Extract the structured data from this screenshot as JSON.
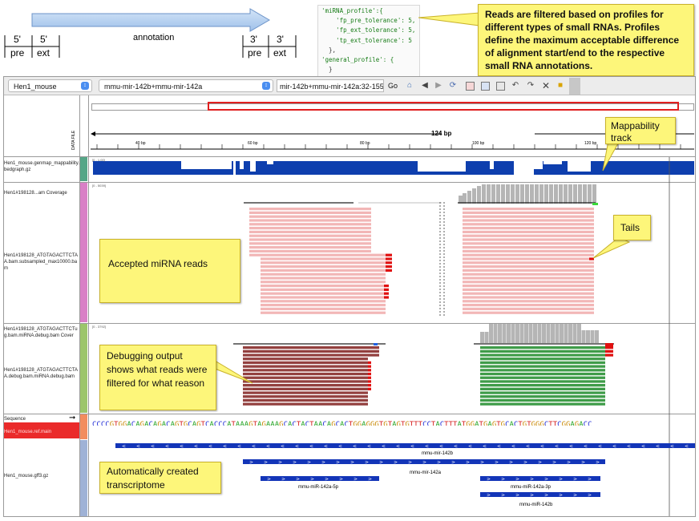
{
  "diagram": {
    "labels": [
      {
        "id": "five-pre",
        "text": "5'"
      },
      {
        "id": "five-pre-sub",
        "text": "pre"
      },
      {
        "id": "five-ext",
        "text": "5'"
      },
      {
        "id": "five-ext-sub",
        "text": "ext"
      },
      {
        "id": "annotation",
        "text": "annotation"
      },
      {
        "id": "three-pre",
        "text": "3'"
      },
      {
        "id": "three-pre-sub",
        "text": "pre"
      },
      {
        "id": "three-ext",
        "text": "3'"
      },
      {
        "id": "three-ext-sub",
        "text": "ext"
      }
    ]
  },
  "code": {
    "lines": [
      "'miRNA_profile':{",
      "    'fp_pre_tolerance': 5,",
      "    'fp_ext_tolerance': 5,",
      "    'tp_ext_tolerance': 5",
      "  },",
      "'general_profile': {",
      "  }"
    ]
  },
  "callouts": {
    "profiles": "Reads are filtered based on profiles for different types of small RNAs. Profiles define the maximum acceptable difference of alignment start/end to the respective small RNA annotations.",
    "mappability": "Mappability track",
    "tails": "Tails",
    "accepted": "Accepted miRNA reads",
    "debugging": "Debugging output shows what reads were filtered for what reason",
    "transcriptome": "Automatically created transcriptome"
  },
  "toolbar": {
    "genome": "Hen1_mouse",
    "locus_dropdown": "mmu-mir-142b+mmu-mir-142a",
    "locus_input": "mir-142b+mmu-mir-142a:32-155",
    "go": "Go"
  },
  "ruler": {
    "span": "124 bp",
    "ticks": [
      "40 bp",
      "60 bp",
      "80 bp",
      "100 bp",
      "120 bp"
    ],
    "data_file_label": "DATA FILE"
  },
  "tracks": {
    "mappability_label": "Hen1_mouse.genmap_mappability.bedgraph.gz",
    "mappability_range": "[0 - 1.00]",
    "coverage1_label": "Hen1#198128...am Coverage",
    "coverage1_range": "[0 - 5039]",
    "reads1_label": "Hen1#198128_ATGTAGACTTCTAA.bam.subsampled_max10000.bam",
    "coverage2_label": "Hen1#198128_ATGTAGACTTCTug.bam.miRNA.debug.bam Cover",
    "coverage2_range": "[0 - 3792]",
    "reads2_label": "Hen1#198128_ATGTAGACTTCTAA.debug.bam.miRNA.debug.bam",
    "sequence_label": "Sequence",
    "reference_label": "Hen1_mouse.ref.main",
    "gff_label": "Hen1_mouse.gff3.gz"
  },
  "sequence": "CCCCGTGGACAGACAGACAGTGCAGTCACCCATAAAGTAGAAAGCACTACTAACAGCACTGGAGGGTGTAGTGTTTCCTACTTTATGGATGAGTGCACTGTGGGCTTCGGAGACC",
  "features": {
    "f1": "mmu-mir-142b",
    "f2": "mmu-mir-142a",
    "f3": "mmu-miR-142a-5p",
    "f4": "mmu-miR-142a-3p",
    "f5": "mmu-miR-142b"
  },
  "colors": {
    "mappability": "#0e3fae",
    "accepted_read": "#f2b6b6",
    "debug_read_brown": "#93403f",
    "debug_read_green": "#3f9c49",
    "tail": "#e01010",
    "coverage": "#b5b5b5",
    "note": "#fdf67a",
    "feature": "#1335b8"
  }
}
